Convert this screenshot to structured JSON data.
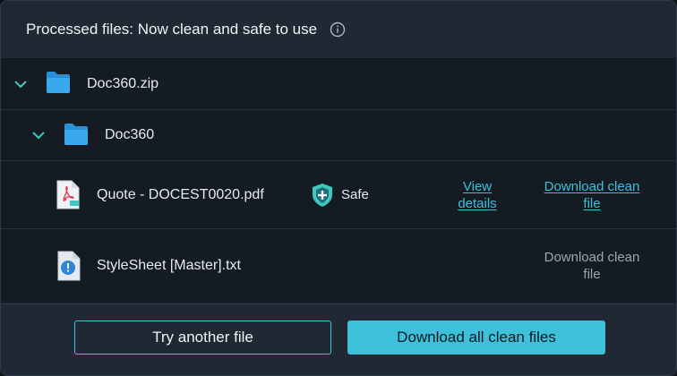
{
  "header": {
    "title": "Processed files: Now clean and safe to use"
  },
  "tree": {
    "archive": {
      "name": "Doc360.zip",
      "icon": "folder-icon"
    },
    "folder": {
      "name": "Doc360",
      "icon": "folder-icon"
    },
    "files": [
      {
        "name": "Quote - DOCEST0020.pdf",
        "icon": "pdf-file-icon",
        "status": "Safe",
        "status_icon": "shield-plus-icon",
        "view_details_line1": "View",
        "view_details_line2": "details",
        "download_line1": "Download clean",
        "download_line2": "file",
        "download_enabled": true
      },
      {
        "name": "StyleSheet [Master].txt",
        "icon": "warning-file-icon",
        "download_line1": "Download clean",
        "download_line2": "file",
        "download_enabled": false
      }
    ]
  },
  "footer": {
    "try_another_label": "Try another file",
    "download_all_label": "Download all clean files"
  },
  "colors": {
    "accent": "#3fc0d9",
    "safe_shield": "#3ec9c0",
    "background": "#141b23"
  }
}
